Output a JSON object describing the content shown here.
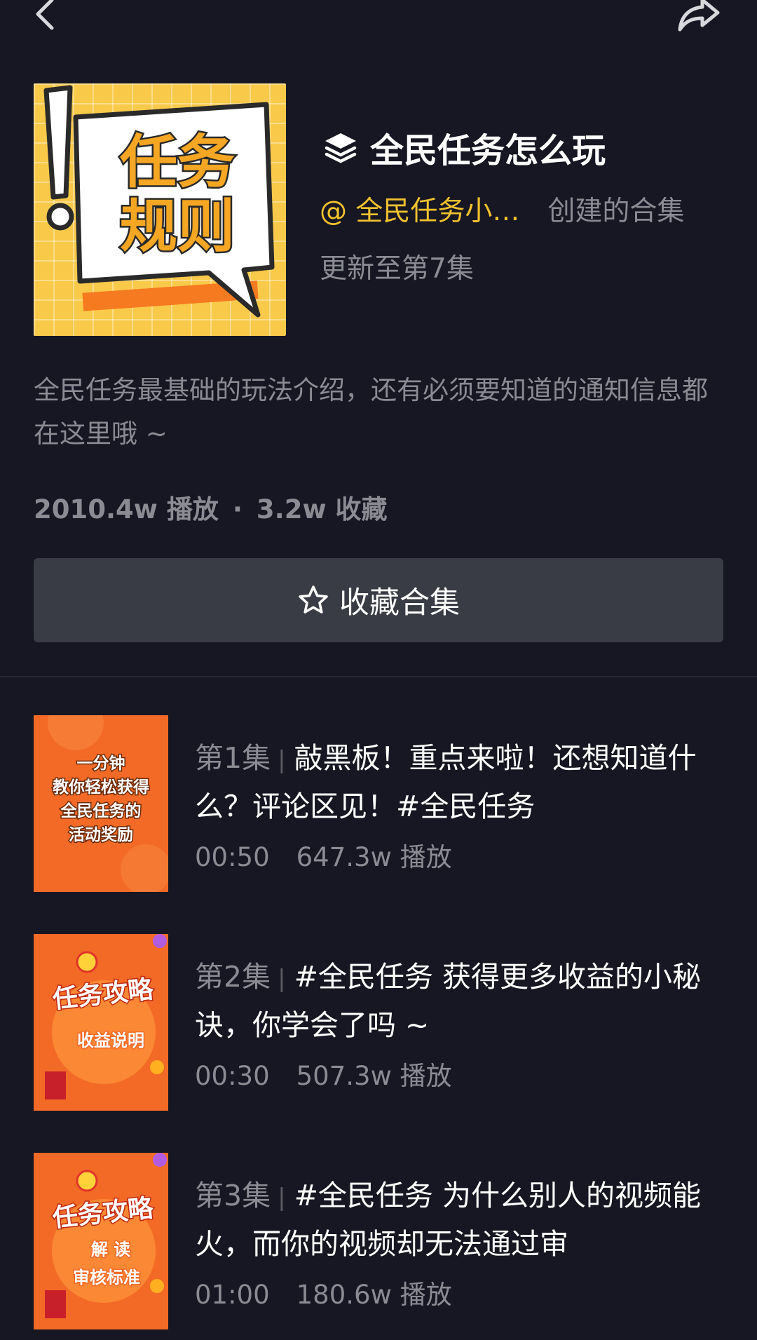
{
  "nav": {
    "back": "back-icon",
    "share": "share-icon"
  },
  "cover": {
    "line1": "任务",
    "line2": "规则",
    "mark": "!"
  },
  "collection": {
    "title": "全民任务怎么玩",
    "creator_name": "@ 全民任务小…",
    "creator_suffix": "创建的合集",
    "update_status": "更新至第7集",
    "description": "全民任务最基础的玩法介绍，还有必须要知道的通知信息都在这里哦 ~",
    "plays": "2010.4w 播放",
    "dot": "·",
    "favorites": "3.2w 收藏"
  },
  "favorite_button": {
    "label": "收藏合集",
    "icon": "star-outline-icon"
  },
  "episodes": [
    {
      "number": "第1集",
      "separator": "|",
      "title": "敲黑板！重点来啦！还想知道什么？评论区见！#全民任务",
      "duration": "00:50",
      "views": "647.3w 播放",
      "thumb_lines": [
        "一分钟",
        "教你轻松获得",
        "全民任务的",
        "活动奖励"
      ]
    },
    {
      "number": "第2集",
      "separator": "|",
      "title": "#全民任务 获得更多收益的小秘诀，你学会了吗 ~",
      "duration": "00:30",
      "views": "507.3w 播放",
      "thumb_lines": [
        "任务攻略",
        "收益说明"
      ]
    },
    {
      "number": "第3集",
      "separator": "|",
      "title": "#全民任务 为什么别人的视频能火，而你的视频却无法通过审",
      "duration": "01:00",
      "views": "180.6w 播放",
      "thumb_lines": [
        "任务攻略",
        "解 读",
        "审核标准"
      ]
    }
  ],
  "colors": {
    "background": "#161722",
    "accent_yellow": "#f2c12e",
    "muted_text": "#8a8b93",
    "button_bg": "#393b45",
    "thumb_orange": "#f36a26"
  }
}
